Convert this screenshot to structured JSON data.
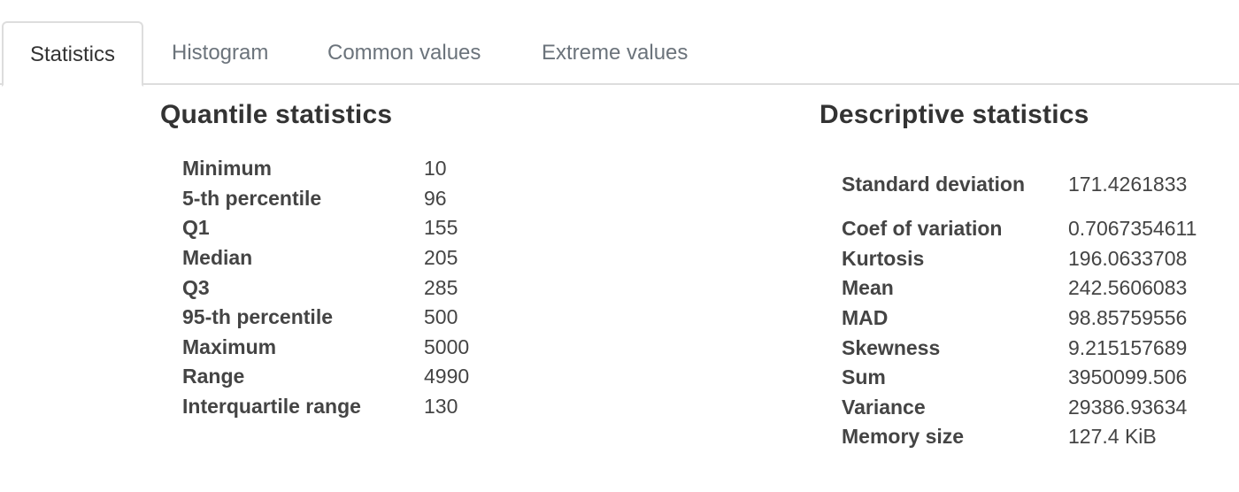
{
  "tabs": [
    {
      "label": "Statistics",
      "active": true
    },
    {
      "label": "Histogram",
      "active": false
    },
    {
      "label": "Common values",
      "active": false
    },
    {
      "label": "Extreme values",
      "active": false
    }
  ],
  "quantile": {
    "title": "Quantile statistics",
    "rows": [
      {
        "label": "Minimum",
        "value": "10"
      },
      {
        "label": "5-th percentile",
        "value": "96"
      },
      {
        "label": "Q1",
        "value": "155"
      },
      {
        "label": "Median",
        "value": "205"
      },
      {
        "label": "Q3",
        "value": "285"
      },
      {
        "label": "95-th percentile",
        "value": "500"
      },
      {
        "label": "Maximum",
        "value": "5000"
      },
      {
        "label": "Range",
        "value": "4990"
      },
      {
        "label": "Interquartile range",
        "value": "130"
      }
    ]
  },
  "descriptive": {
    "title": "Descriptive statistics",
    "rows": [
      {
        "label": "Standard deviation",
        "value": "171.4261833"
      },
      {
        "label": "Coef of variation",
        "value": "0.7067354611"
      },
      {
        "label": "Kurtosis",
        "value": "196.0633708"
      },
      {
        "label": "Mean",
        "value": "242.5606083"
      },
      {
        "label": "MAD",
        "value": "98.85759556"
      },
      {
        "label": "Skewness",
        "value": "9.215157689"
      },
      {
        "label": "Sum",
        "value": "3950099.506"
      },
      {
        "label": "Variance",
        "value": "29386.93634"
      },
      {
        "label": "Memory size",
        "value": "127.4 KiB"
      }
    ]
  }
}
